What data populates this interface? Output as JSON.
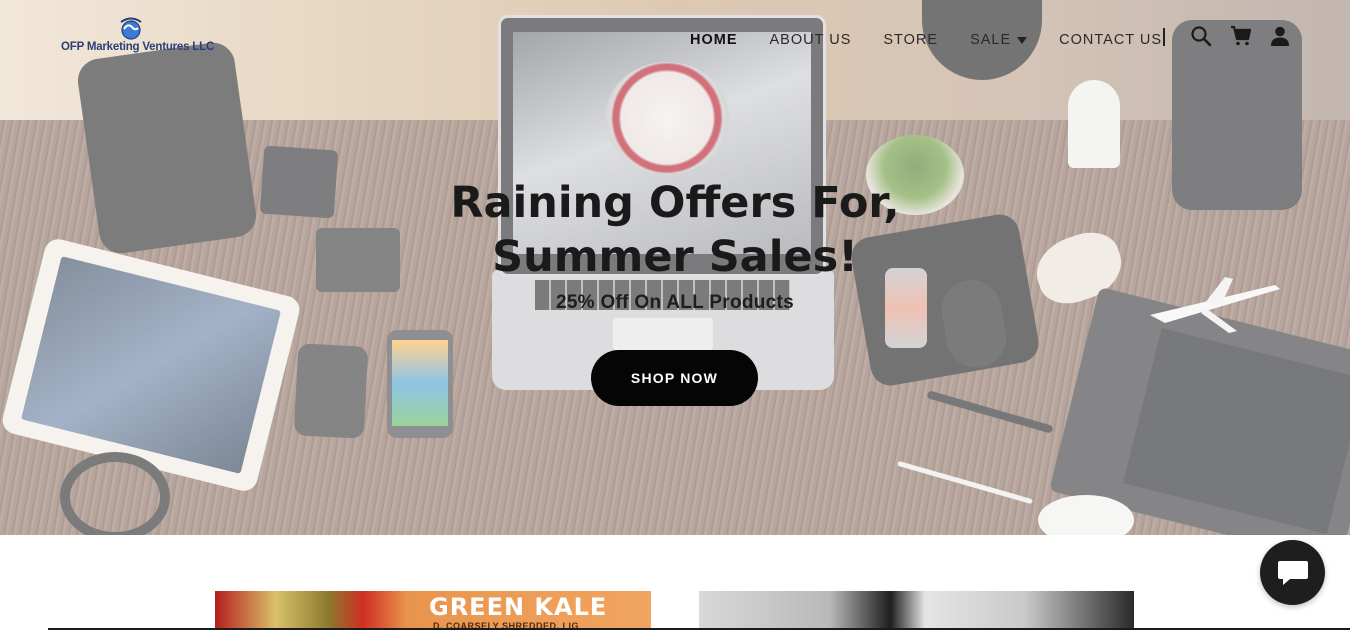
{
  "brand": {
    "name": "OFP Marketing Ventures LLC",
    "logo_icon": "globe-icon"
  },
  "nav": {
    "items": [
      {
        "label": "HOME",
        "active": true
      },
      {
        "label": "ABOUT US",
        "active": false
      },
      {
        "label": "STORE",
        "active": false
      },
      {
        "label": "SALE",
        "active": false,
        "has_dropdown": true
      },
      {
        "label": "CONTACT US",
        "active": false
      }
    ],
    "icons": [
      "search-icon",
      "cart-icon",
      "account-icon"
    ]
  },
  "hero": {
    "title_line1": "Raining Offers For,",
    "title_line2": "Summer Sales!",
    "subtitle": "25% Off On ALL Products",
    "cta_label": "SHOP NOW"
  },
  "products_preview": {
    "card1_text": "GREEN KALE",
    "card1_subtext": "D, COARSELY SHREDDED, LIG"
  },
  "chat": {
    "icon": "chat-bubble-icon"
  },
  "colors": {
    "logo_text": "#2b3e77",
    "button_bg": "#050505",
    "button_text": "#ffffff",
    "chat_bg": "#1e1e1e"
  }
}
